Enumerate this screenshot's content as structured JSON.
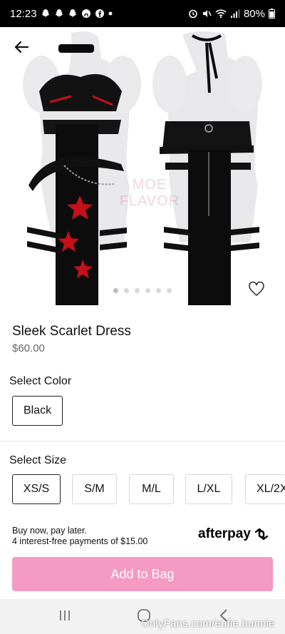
{
  "status_bar": {
    "time": "12:23",
    "battery": "80%"
  },
  "product": {
    "title": "Sleek Scarlet Dress",
    "price": "$60.00",
    "watermark": "MOE FLAVOR",
    "image_count": 6,
    "active_image": 1
  },
  "color": {
    "label": "Select Color",
    "options": [
      "Black"
    ],
    "selected": "Black"
  },
  "size": {
    "label": "Select Size",
    "options": [
      "XS/S",
      "S/M",
      "M/L",
      "L/XL",
      "XL/2X"
    ],
    "selected": "XS/S"
  },
  "afterpay": {
    "line1": "Buy now, pay later.",
    "line2": "4 interest-free payments of $15.00",
    "logo": "afterpay"
  },
  "add_to_bag": "Add to Bag",
  "overlay_text": "OnlyFans.com/eufie.bunnie",
  "colors": {
    "accent_pink": "#f59ac2",
    "status_bar_bg": "#000000"
  },
  "icons": [
    "back-arrow-icon",
    "heart-icon",
    "recent-apps-icon",
    "home-icon",
    "back-nav-icon"
  ]
}
